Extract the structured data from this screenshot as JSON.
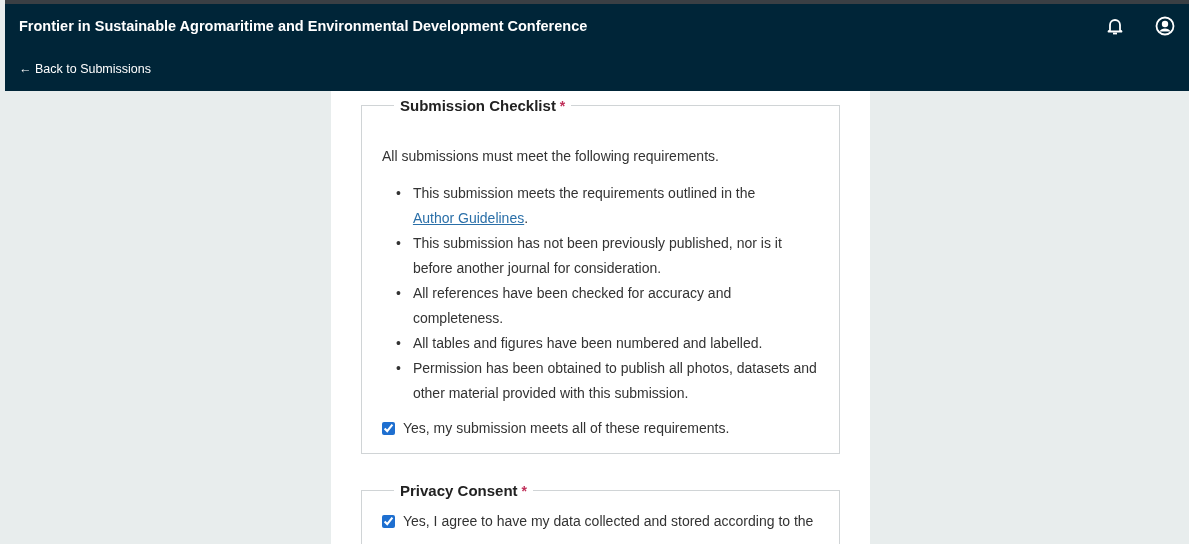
{
  "header": {
    "title": "Frontier in Sustainable Agromaritime and Environmental Development Conference",
    "back_link": "← Back to Submissions"
  },
  "checklist": {
    "legend": "Submission Checklist",
    "required_mark": "*",
    "intro": "All submissions must meet the following requirements.",
    "items": [
      {
        "marker": "•",
        "text": "This submission meets the requirements outlined in the ",
        "link": "Author Guidelines",
        "after": "."
      },
      {
        "marker": "•",
        "text": "This submission has not been previously published, nor is it before another journal for consideration."
      },
      {
        "marker": "•",
        "text": "All references have been checked for accuracy and completeness."
      },
      {
        "marker": "•",
        "text": "All tables and figures have been numbered and labelled."
      },
      {
        "marker": "•",
        "text": "Permission has been obtained to publish all photos, datasets and other material provided with this submission."
      }
    ],
    "confirm": {
      "label": "Yes, my submission meets all of these requirements.",
      "checked": true
    }
  },
  "privacy": {
    "legend": "Privacy Consent",
    "required_mark": "*",
    "confirm": {
      "label": "Yes, I agree to have my data collected and stored according to the",
      "checked": true
    }
  }
}
